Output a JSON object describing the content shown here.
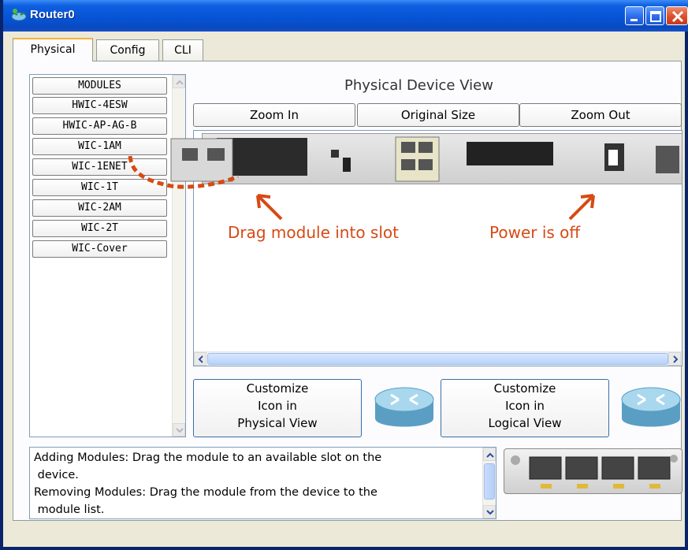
{
  "window": {
    "title": "Router0",
    "controls": [
      "minimize",
      "maximize",
      "close"
    ]
  },
  "tabs": [
    {
      "label": "Physical",
      "active": true
    },
    {
      "label": "Config",
      "active": false
    },
    {
      "label": "CLI",
      "active": false
    }
  ],
  "modules": {
    "header": "MODULES",
    "items": [
      "HWIC-4ESW",
      "HWIC-AP-AG-B",
      "WIC-1AM",
      "WIC-1ENET",
      "WIC-1T",
      "WIC-2AM",
      "WIC-2T",
      "WIC-Cover"
    ]
  },
  "device_view": {
    "title": "Physical Device View",
    "zoom_in": "Zoom In",
    "original_size": "Original Size",
    "zoom_out": "Zoom Out"
  },
  "annotations": {
    "drag": "Drag module into slot",
    "power": "Power is off",
    "color": "#d64a14"
  },
  "customize": {
    "physical": [
      "Customize",
      "Icon in",
      "Physical View"
    ],
    "logical": [
      "Customize",
      "Icon in",
      "Logical View"
    ]
  },
  "info": {
    "line1": "Adding Modules: Drag the module to an available slot on the",
    "line2": " device.",
    "line3": "Removing Modules: Drag the module from the device to the",
    "line4": " module list."
  },
  "colors": {
    "titlebar": "#0553d4",
    "accent_tab": "#f9b13a",
    "annotation": "#d64a14"
  }
}
